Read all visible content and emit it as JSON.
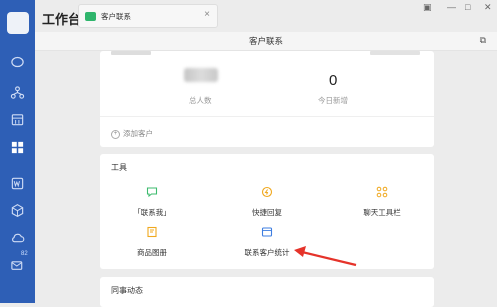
{
  "app": {
    "title": "工作台"
  },
  "tab": {
    "label": "客户联系",
    "close": "×"
  },
  "header": {
    "title": "客户联系"
  },
  "stats": [
    {
      "value": "",
      "label": "总人数"
    },
    {
      "value": "0",
      "label": "今日新增"
    }
  ],
  "add_customer": "添加客户",
  "tools": {
    "title": "工具",
    "items": [
      {
        "label": "「联系我」",
        "icon": "chat-bubble-icon",
        "color": "#3dbb6e"
      },
      {
        "label": "快捷回复",
        "icon": "quick-reply-icon",
        "color": "#f0a81e"
      },
      {
        "label": "聊天工具栏",
        "icon": "toolbar-grid-icon",
        "color": "#f0a81e"
      },
      {
        "label": "商品图册",
        "icon": "product-album-icon",
        "color": "#f0a81e"
      },
      {
        "label": "联系客户统计",
        "icon": "statistics-icon",
        "color": "#3e7ee0"
      }
    ]
  },
  "colleague": {
    "title": "同事动态"
  },
  "sidebar": {
    "badge": "82"
  },
  "colors": {
    "rail": "#2e5fb6",
    "arrow": "#e5332a",
    "accent": "#3e7ee0"
  }
}
